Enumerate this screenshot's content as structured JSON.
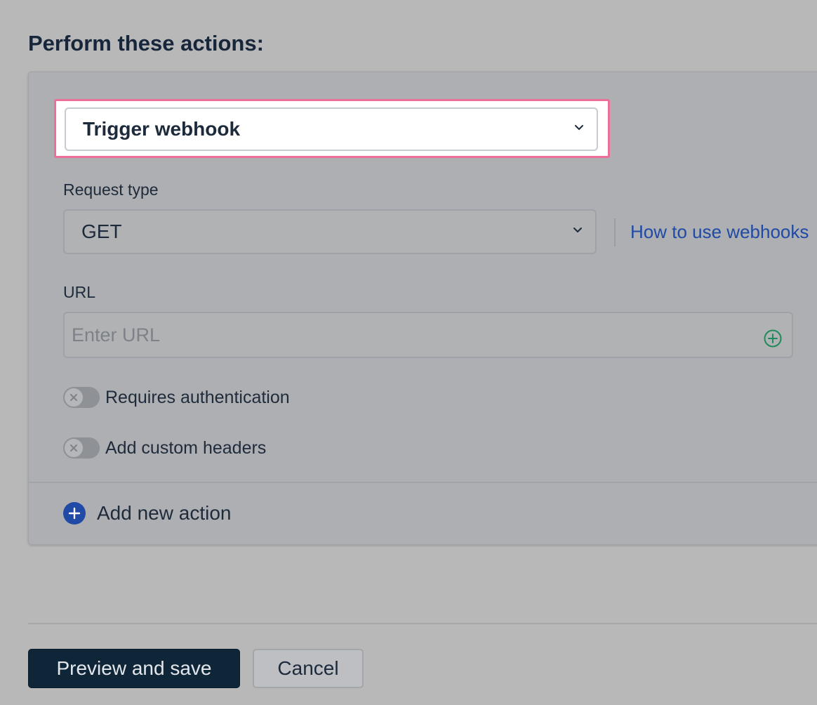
{
  "section": {
    "title": "Perform these actions:"
  },
  "action": {
    "selected": "Trigger webhook",
    "highlight_color": "#ec6f97"
  },
  "request_type": {
    "label": "Request type",
    "value": "GET"
  },
  "help_link": {
    "label": "How to use webhooks",
    "color": "#1f4aa6"
  },
  "url": {
    "label": "URL",
    "value": "",
    "placeholder": "Enter URL",
    "add_icon": "plus-circle-icon"
  },
  "toggles": [
    {
      "label": "Requires authentication",
      "enabled": false
    },
    {
      "label": "Add custom headers",
      "enabled": false
    }
  ],
  "add_action": {
    "label": "Add new action",
    "icon": "plus-circle-icon",
    "icon_color": "#1f4aa6"
  },
  "footer": {
    "primary_label": "Preview and save",
    "secondary_label": "Cancel",
    "primary_color": "#0f2538"
  }
}
